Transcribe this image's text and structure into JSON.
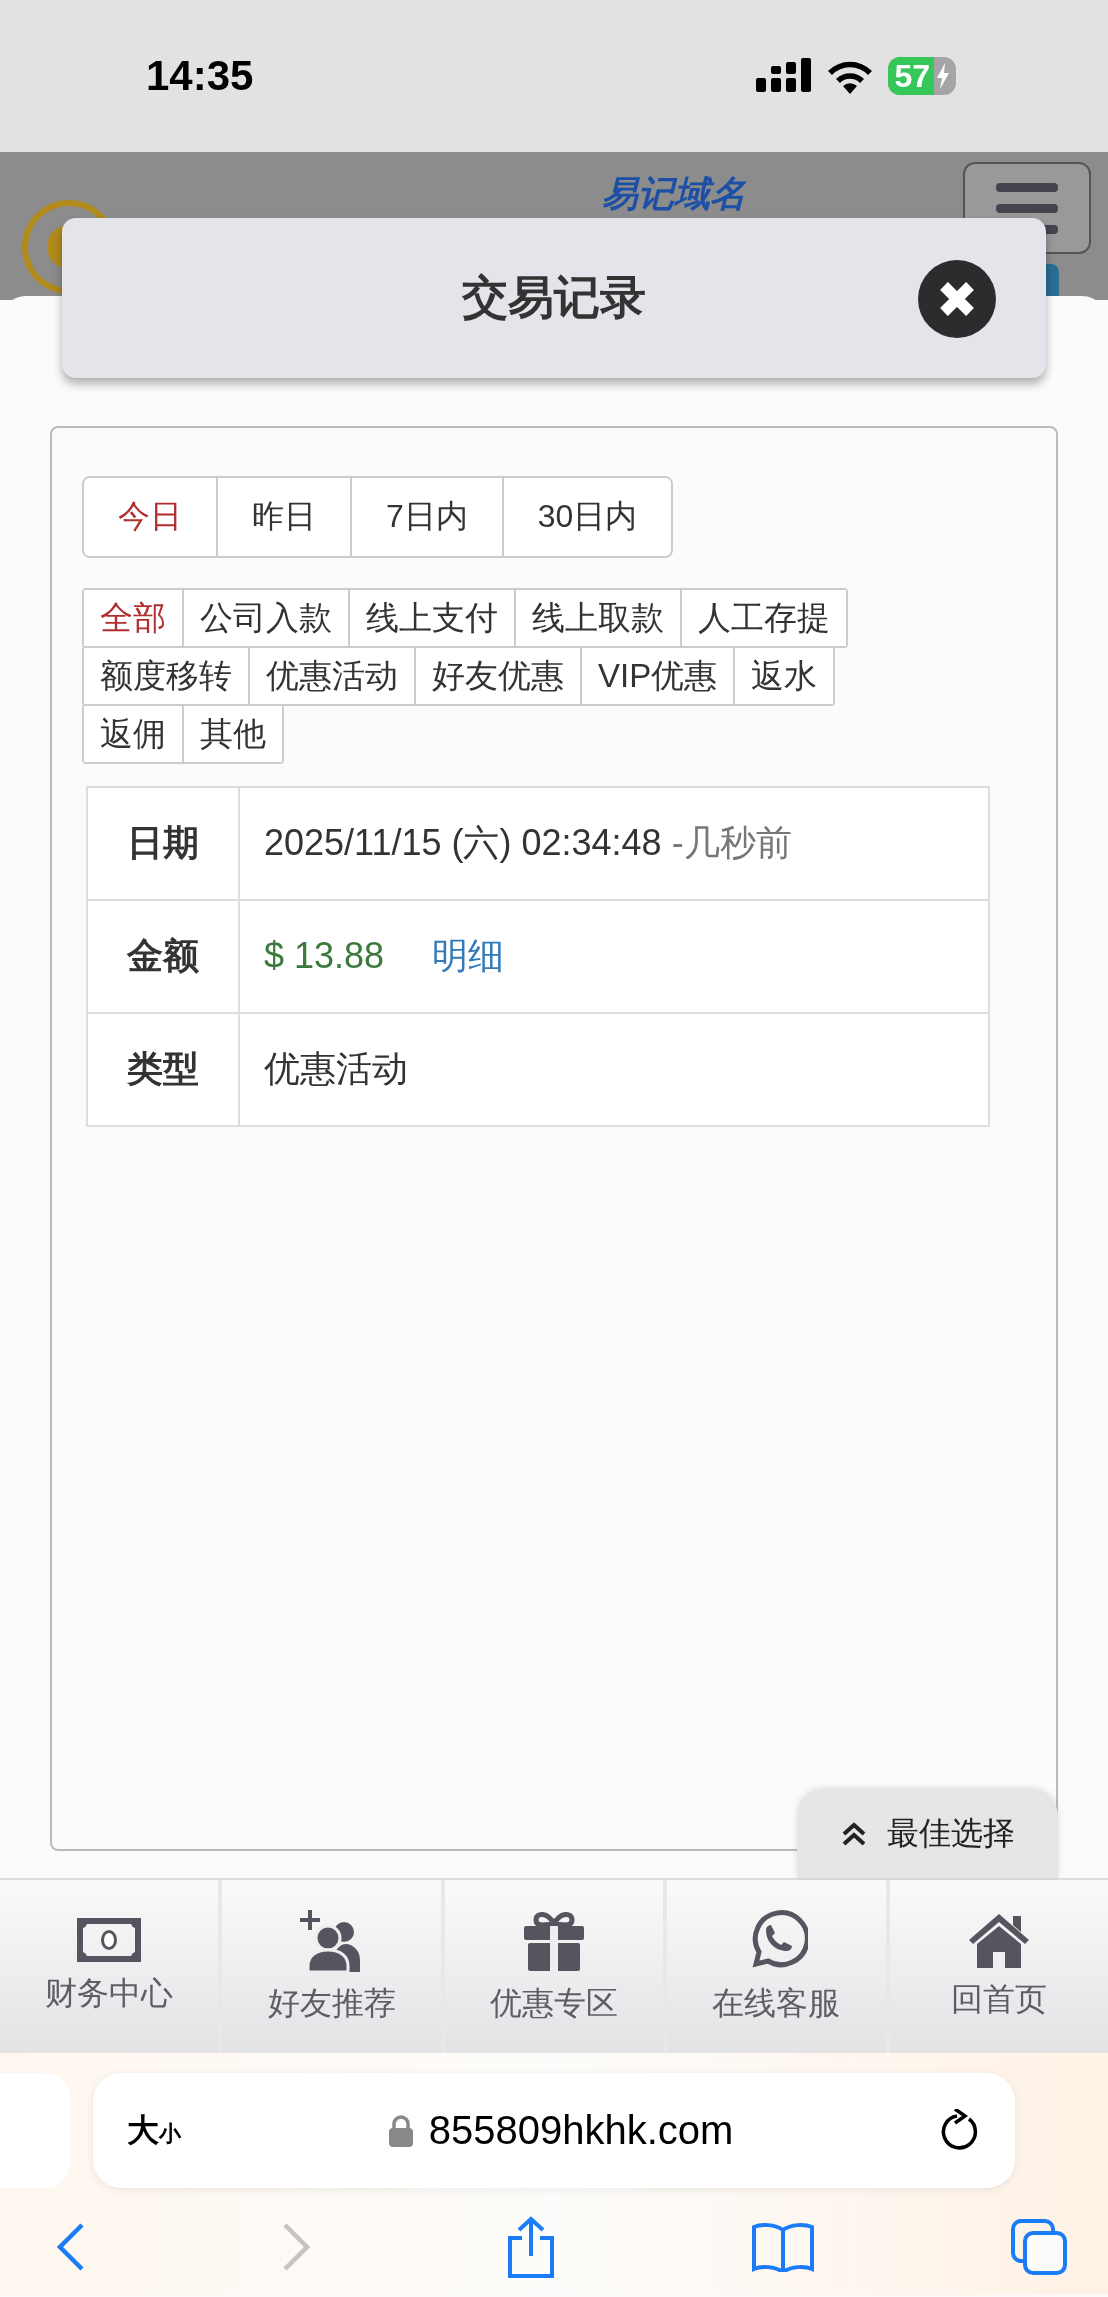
{
  "status_bar": {
    "time": "14:35",
    "battery": "57"
  },
  "site_header": {
    "tagline": "易记域名"
  },
  "modal": {
    "title": "交易记录"
  },
  "period_tabs": [
    {
      "label": "今日",
      "selected": true
    },
    {
      "label": "昨日",
      "selected": false
    },
    {
      "label": "7日内",
      "selected": false
    },
    {
      "label": "30日内",
      "selected": false
    }
  ],
  "category_rows": [
    [
      {
        "label": "全部",
        "selected": true
      },
      {
        "label": "公司入款",
        "selected": false
      },
      {
        "label": "线上支付",
        "selected": false
      },
      {
        "label": "线上取款",
        "selected": false
      },
      {
        "label": "人工存提",
        "selected": false
      }
    ],
    [
      {
        "label": "额度移转",
        "selected": false
      },
      {
        "label": "优惠活动",
        "selected": false
      },
      {
        "label": "好友优惠",
        "selected": false
      },
      {
        "label": "VIP优惠",
        "selected": false
      },
      {
        "label": "返水",
        "selected": false
      }
    ],
    [
      {
        "label": "返佣",
        "selected": false
      },
      {
        "label": "其他",
        "selected": false
      }
    ]
  ],
  "record": [
    {
      "kind": "date",
      "label": "日期",
      "value": "2025/11/15 (六) 02:34:48",
      "note": "-几秒前"
    },
    {
      "kind": "amount",
      "label": "金额",
      "value": "$ 13.88",
      "link": "明细"
    },
    {
      "kind": "text",
      "label": "类型",
      "value": "优惠活动"
    }
  ],
  "best_choice": {
    "label": "最佳选择"
  },
  "bottom_nav": [
    {
      "kind": "money",
      "label": "财务中心"
    },
    {
      "kind": "friends",
      "label": "好友推荐"
    },
    {
      "kind": "gift",
      "label": "优惠专区"
    },
    {
      "kind": "chat",
      "label": "在线客服"
    },
    {
      "kind": "home",
      "label": "回首页"
    }
  ],
  "browser": {
    "size_large": "大",
    "size_small": "小",
    "url": "855809hkhk.com"
  }
}
